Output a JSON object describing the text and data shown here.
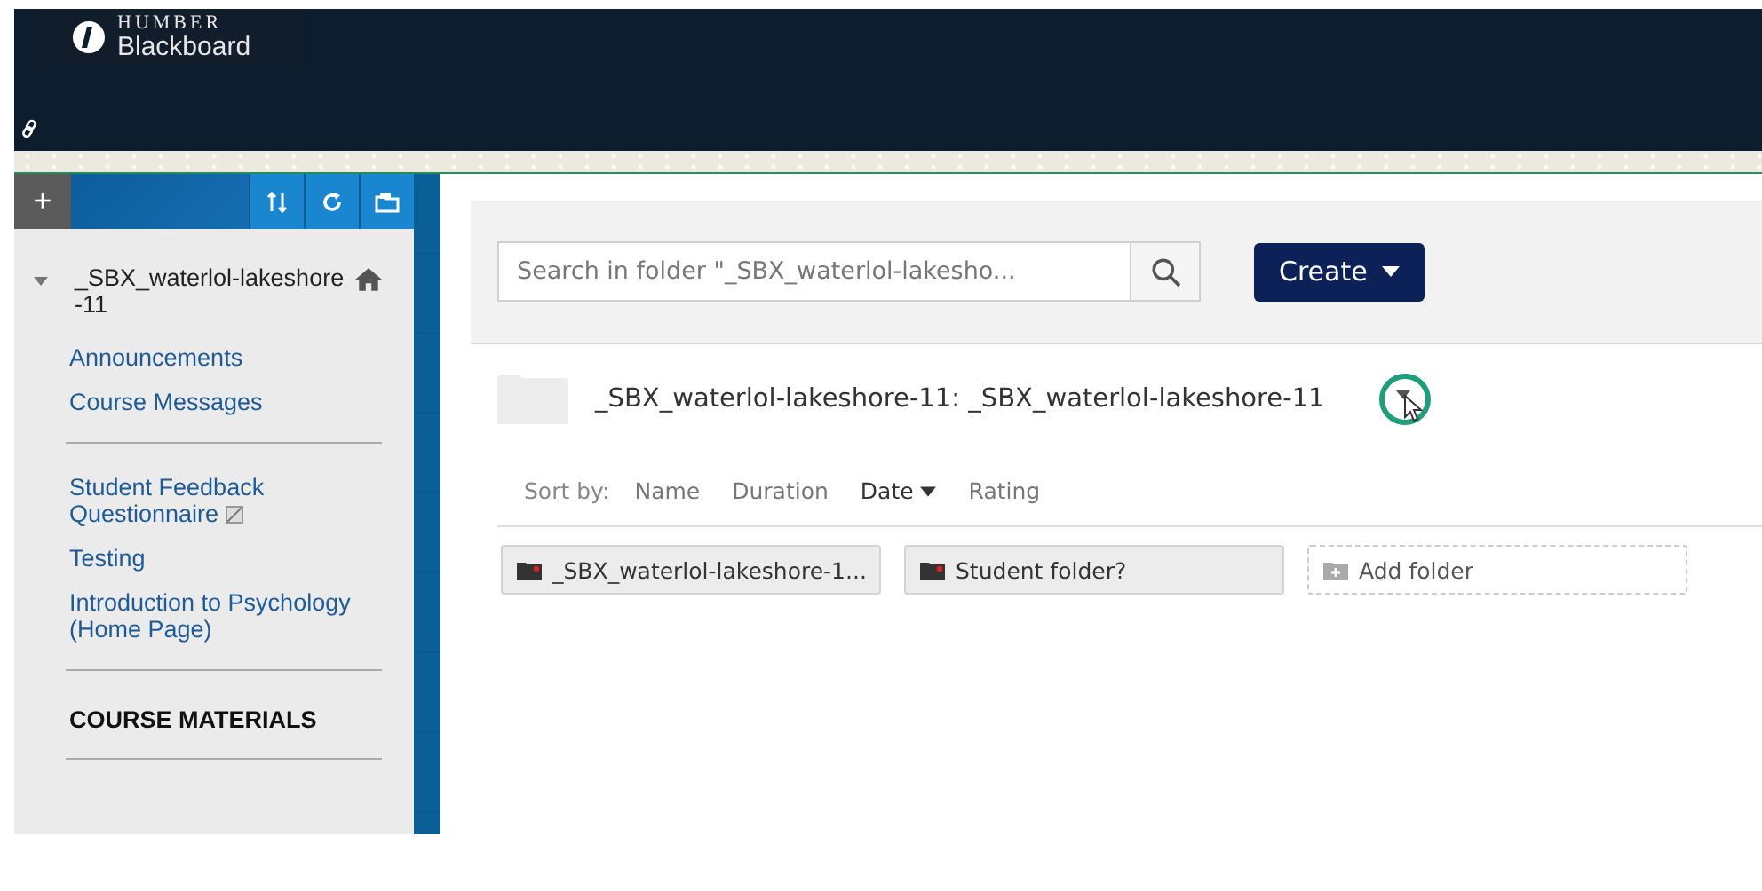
{
  "header": {
    "logo_top": "HUMBER",
    "logo_bottom": "Blackboard"
  },
  "sidebar": {
    "toolbar": {
      "add": "+"
    },
    "course": {
      "title": "_SBX_waterlol-lakeshore-11",
      "expanded": true
    },
    "items": [
      {
        "kind": "link",
        "label": "Announcements"
      },
      {
        "kind": "link",
        "label": "Course Messages"
      },
      {
        "kind": "divider"
      },
      {
        "kind": "link",
        "label": "Student Feedback Questionnaire",
        "hidden_mark": true
      },
      {
        "kind": "link",
        "label": "Testing"
      },
      {
        "kind": "link",
        "label": "Introduction to Psychology (Home Page)"
      },
      {
        "kind": "divider"
      },
      {
        "kind": "heading",
        "label": "COURSE MATERIALS"
      },
      {
        "kind": "divider"
      }
    ]
  },
  "toolbar": {
    "search": {
      "placeholder": "Search in folder \"_SBX_waterlol-lakesho..."
    },
    "create": "Create"
  },
  "folder": {
    "title": "_SBX_waterlol-lakeshore-11: _SBX_waterlol-lakeshore-11"
  },
  "sort": {
    "label": "Sort by:",
    "options": [
      {
        "label": "Name",
        "selected": false
      },
      {
        "label": "Duration",
        "selected": false
      },
      {
        "label": "Date",
        "selected": true
      },
      {
        "label": "Rating",
        "selected": false
      }
    ]
  },
  "folders": [
    {
      "kind": "folder",
      "label": "_SBX_waterlol-lakeshore-1..."
    },
    {
      "kind": "folder",
      "label": "Student folder?"
    },
    {
      "kind": "add",
      "label": "Add folder"
    }
  ]
}
